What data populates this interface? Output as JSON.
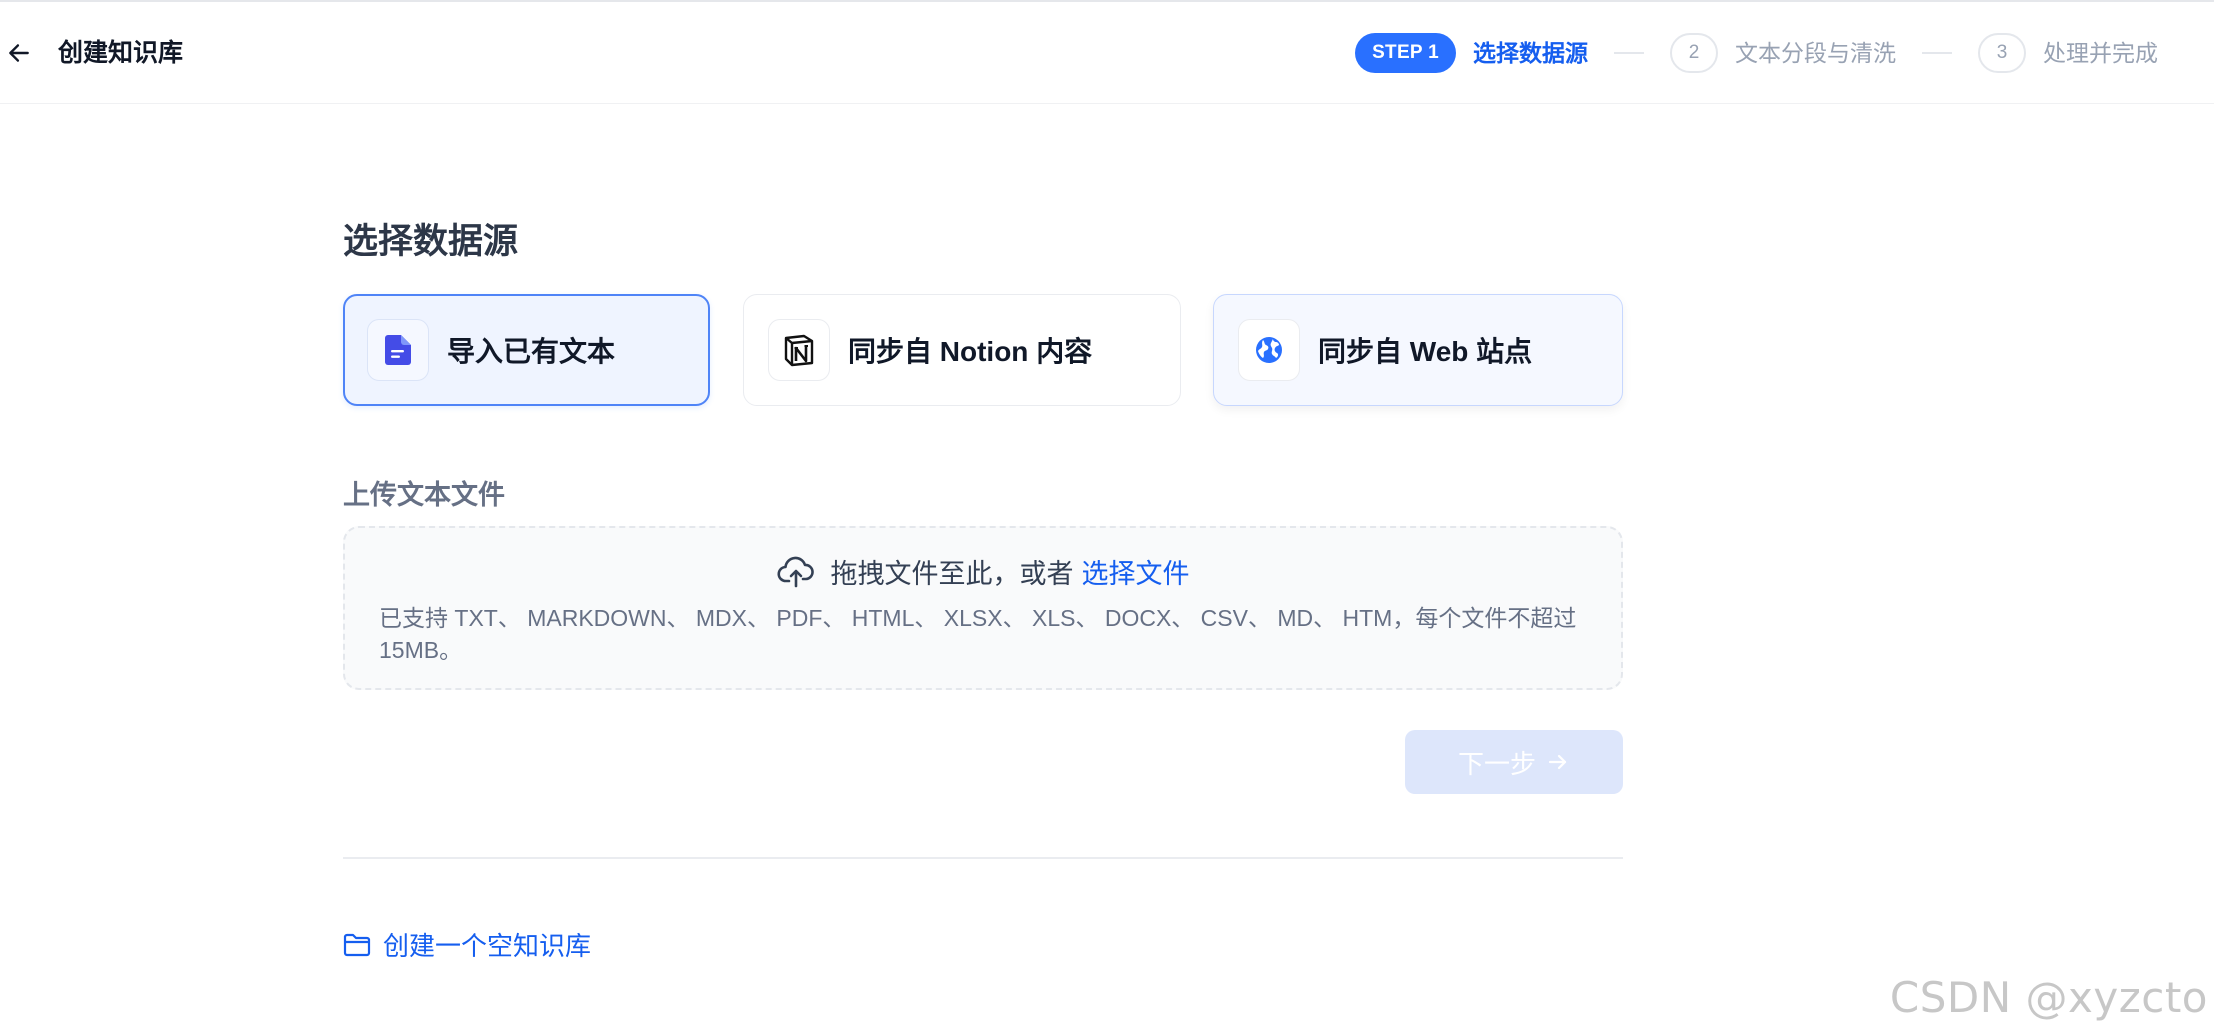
{
  "header": {
    "title": "创建知识库",
    "steps": [
      {
        "badge": "STEP 1",
        "label": "选择数据源",
        "state": "active"
      },
      {
        "badge": "2",
        "label": "文本分段与清洗",
        "state": "inactive"
      },
      {
        "badge": "3",
        "label": "处理并完成",
        "state": "inactive"
      }
    ]
  },
  "main": {
    "section_title": "选择数据源",
    "sources": [
      {
        "label": "导入已有文本",
        "icon": "file-text-icon",
        "selected": true
      },
      {
        "label": "同步自 Notion 内容",
        "icon": "notion-icon",
        "selected": false
      },
      {
        "label": "同步自 Web 站点",
        "icon": "globe-icon",
        "selected": false
      }
    ],
    "upload": {
      "title": "上传文本文件",
      "drop_text": "拖拽文件至此，或者",
      "select_link": "选择文件",
      "support_text": "已支持 TXT、 MARKDOWN、 MDX、 PDF、 HTML、 XLSX、 XLS、 DOCX、 CSV、 MD、 HTM，每个文件不超过 15MB。"
    },
    "next_button": "下一步",
    "empty_kb_link": "创建一个空知识库"
  },
  "watermark": "CSDN @xyzcto",
  "colors": {
    "accent": "#155eef",
    "step_pill": "#2970ff",
    "disabled_button": "#dde6fb"
  }
}
